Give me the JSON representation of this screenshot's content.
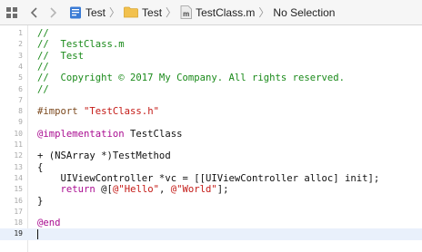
{
  "jumpbar": {
    "items": [
      {
        "label": "Test",
        "icon": "xcode-project-icon"
      },
      {
        "label": "Test",
        "icon": "folder-icon"
      },
      {
        "label": "TestClass.m",
        "icon": "objc-m-file-icon"
      },
      {
        "label": "No Selection"
      }
    ]
  },
  "editor": {
    "current_line": 19,
    "lines": [
      {
        "n": "1",
        "tokens": [
          {
            "t": "//",
            "c": "comment"
          }
        ]
      },
      {
        "n": "2",
        "tokens": [
          {
            "t": "//  TestClass.m",
            "c": "comment"
          }
        ]
      },
      {
        "n": "3",
        "tokens": [
          {
            "t": "//  Test",
            "c": "comment"
          }
        ]
      },
      {
        "n": "4",
        "tokens": [
          {
            "t": "//",
            "c": "comment"
          }
        ]
      },
      {
        "n": "5",
        "tokens": [
          {
            "t": "//  Copyright © 2017 My Company. All rights reserved.",
            "c": "comment"
          }
        ]
      },
      {
        "n": "6",
        "tokens": [
          {
            "t": "//",
            "c": "comment"
          }
        ]
      },
      {
        "n": "7",
        "tokens": []
      },
      {
        "n": "8",
        "tokens": [
          {
            "t": "#import ",
            "c": "pre"
          },
          {
            "t": "\"TestClass.h\"",
            "c": "str"
          }
        ]
      },
      {
        "n": "9",
        "tokens": []
      },
      {
        "n": "10",
        "tokens": [
          {
            "t": "@implementation",
            "c": "kw"
          },
          {
            "t": " TestClass",
            "c": "plain"
          }
        ]
      },
      {
        "n": "11",
        "tokens": []
      },
      {
        "n": "12",
        "tokens": [
          {
            "t": "+ (NSArray *)TestMethod",
            "c": "plain"
          }
        ]
      },
      {
        "n": "13",
        "tokens": [
          {
            "t": "{",
            "c": "plain"
          }
        ]
      },
      {
        "n": "14",
        "tokens": [
          {
            "t": "    UIViewController *vc = [[UIViewController alloc] init];",
            "c": "plain"
          }
        ]
      },
      {
        "n": "15",
        "tokens": [
          {
            "t": "    ",
            "c": "plain"
          },
          {
            "t": "return",
            "c": "kw"
          },
          {
            "t": " @[",
            "c": "plain"
          },
          {
            "t": "@\"Hello\"",
            "c": "str"
          },
          {
            "t": ", ",
            "c": "plain"
          },
          {
            "t": "@\"World\"",
            "c": "str"
          },
          {
            "t": "];",
            "c": "plain"
          }
        ]
      },
      {
        "n": "16",
        "tokens": [
          {
            "t": "}",
            "c": "plain"
          }
        ]
      },
      {
        "n": "17",
        "tokens": []
      },
      {
        "n": "18",
        "tokens": [
          {
            "t": "@end",
            "c": "kw"
          }
        ]
      },
      {
        "n": "19",
        "tokens": []
      }
    ]
  }
}
